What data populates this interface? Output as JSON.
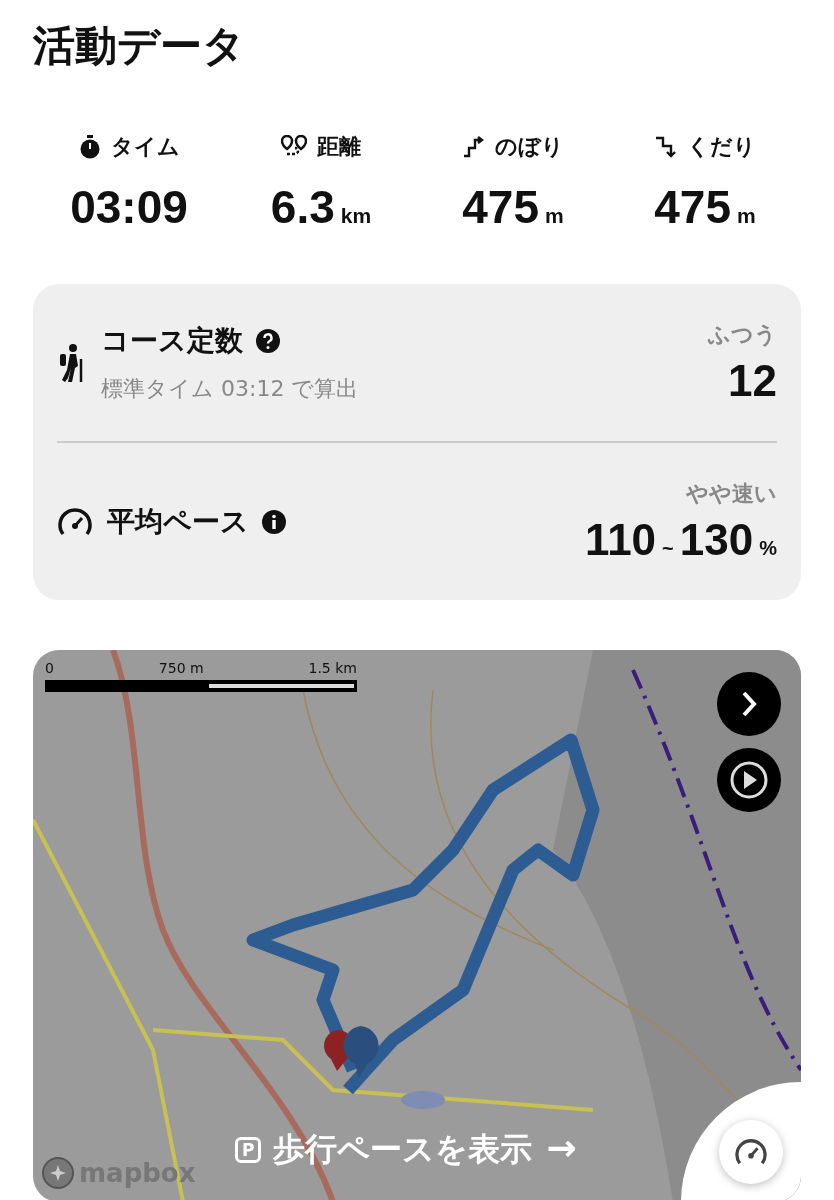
{
  "title": "活動データ",
  "stats": [
    {
      "kind": "time",
      "label": "タイム",
      "value": "03:09"
    },
    {
      "kind": "distance",
      "label": "距離",
      "value": "6.3",
      "unit": "km"
    },
    {
      "kind": "up",
      "label": "のぼり",
      "value": "475",
      "unit": "m"
    },
    {
      "kind": "down",
      "label": "くだり",
      "value": "475",
      "unit": "m"
    }
  ],
  "summary": [
    {
      "kind": "course",
      "title": "コース定数",
      "subtitle": "標準タイム 03:12 で算出",
      "rating": "ふつう",
      "value": "12"
    },
    {
      "kind": "pace",
      "title": "平均ペース",
      "rating": "やや速い",
      "value_low": "110",
      "separator": "~",
      "value_high": "130",
      "unit": "%"
    }
  ],
  "map": {
    "kind": "picture",
    "scale_labels": [
      "0",
      "750 m",
      "1.5 km"
    ],
    "attribution": "mapbox",
    "pace_badge": "P",
    "pace_label": "歩行ペースを表示",
    "pace_arrow": "→"
  }
}
